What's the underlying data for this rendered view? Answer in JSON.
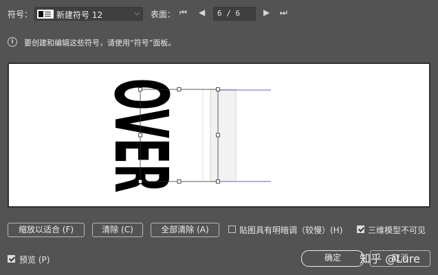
{
  "toolbar": {
    "symbol_label": "符号：",
    "symbol_value": "新建符号 12",
    "surface_label": "表面：",
    "page_indicator": "6 / 6"
  },
  "info": {
    "message": "要创建和编辑这些符号，请使用“符号”面板。"
  },
  "preview": {
    "symbol_text": "OVER"
  },
  "buttons": {
    "fit": "缩放以适合 (F)",
    "clear": "清除 (C)",
    "clear_all": "全部清除 (A)",
    "ok": "确定",
    "cancel": "取消"
  },
  "options": {
    "shade_artwork": {
      "label": "贴图具有明暗调（较慢）(H)",
      "checked": false
    },
    "invisible_geometry": {
      "label": "三维模型不可见",
      "checked": true
    },
    "preview": {
      "label": "预览 (P)",
      "checked": true
    }
  },
  "watermark": "知乎 @Lure",
  "colors": {
    "background": "#535353",
    "guide_line": "#6a5fb8"
  }
}
